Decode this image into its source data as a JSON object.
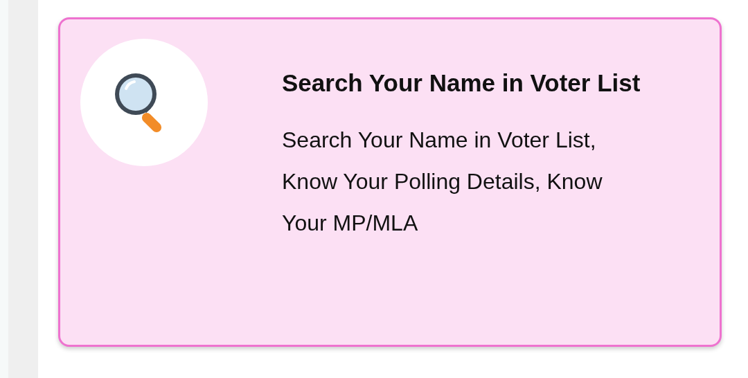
{
  "card": {
    "title": "Search Your Name in Voter List",
    "description": "Search Your Name in Voter List, Know Your Polling Details, Know Your MP/MLA"
  }
}
